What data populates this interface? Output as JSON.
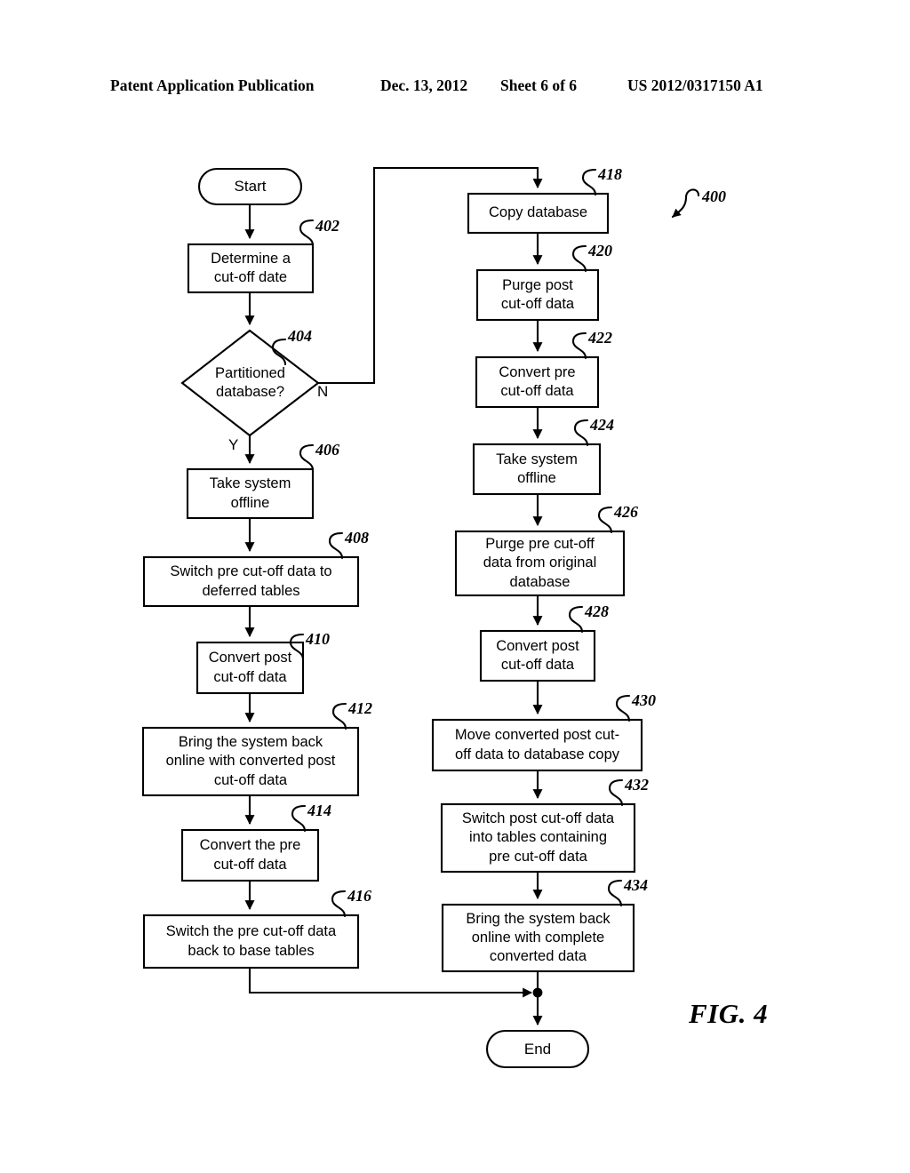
{
  "header": {
    "publication": "Patent Application Publication",
    "date": "Dec. 13, 2012",
    "sheet": "Sheet 6 of 6",
    "patent_number": "US 2012/0317150 A1"
  },
  "figure": {
    "caption": "FIG. 4",
    "diagram_ref": "400"
  },
  "flowchart": {
    "type": "process-flow",
    "start": {
      "ref": "",
      "label": "Start",
      "shape": "terminal"
    },
    "end": {
      "ref": "",
      "label": "End",
      "shape": "terminal"
    },
    "decision_branches": {
      "yes": "Y",
      "no": "N"
    },
    "nodes": [
      {
        "ref": "402",
        "label": "Determine a\ncut-off date",
        "shape": "process",
        "column": "left"
      },
      {
        "ref": "404",
        "label": "Partitioned\ndatabase?",
        "shape": "decision",
        "column": "left"
      },
      {
        "ref": "406",
        "label": "Take system\noffline",
        "shape": "process",
        "column": "left"
      },
      {
        "ref": "408",
        "label": "Switch pre cut-off data to\ndeferred tables",
        "shape": "process",
        "column": "left"
      },
      {
        "ref": "410",
        "label": "Convert post\ncut-off data",
        "shape": "process",
        "column": "left"
      },
      {
        "ref": "412",
        "label": "Bring the system back\nonline with converted post\ncut-off data",
        "shape": "process",
        "column": "left"
      },
      {
        "ref": "414",
        "label": "Convert the pre\ncut-off data",
        "shape": "process",
        "column": "left"
      },
      {
        "ref": "416",
        "label": "Switch the pre cut-off data\nback to base tables",
        "shape": "process",
        "column": "left"
      },
      {
        "ref": "418",
        "label": "Copy database",
        "shape": "process",
        "column": "right"
      },
      {
        "ref": "420",
        "label": "Purge post\ncut-off data",
        "shape": "process",
        "column": "right"
      },
      {
        "ref": "422",
        "label": "Convert pre\ncut-off data",
        "shape": "process",
        "column": "right"
      },
      {
        "ref": "424",
        "label": "Take system\noffline",
        "shape": "process",
        "column": "right"
      },
      {
        "ref": "426",
        "label": "Purge pre cut-off\ndata from original\ndatabase",
        "shape": "process",
        "column": "right"
      },
      {
        "ref": "428",
        "label": "Convert post\ncut-off data",
        "shape": "process",
        "column": "right"
      },
      {
        "ref": "430",
        "label": "Move converted post cut-\noff data to database copy",
        "shape": "process",
        "column": "right"
      },
      {
        "ref": "432",
        "label": "Switch post cut-off data\ninto tables containing\npre cut-off data",
        "shape": "process",
        "column": "right"
      },
      {
        "ref": "434",
        "label": "Bring the system back\nonline with complete\nconverted data",
        "shape": "process",
        "column": "right"
      }
    ]
  }
}
